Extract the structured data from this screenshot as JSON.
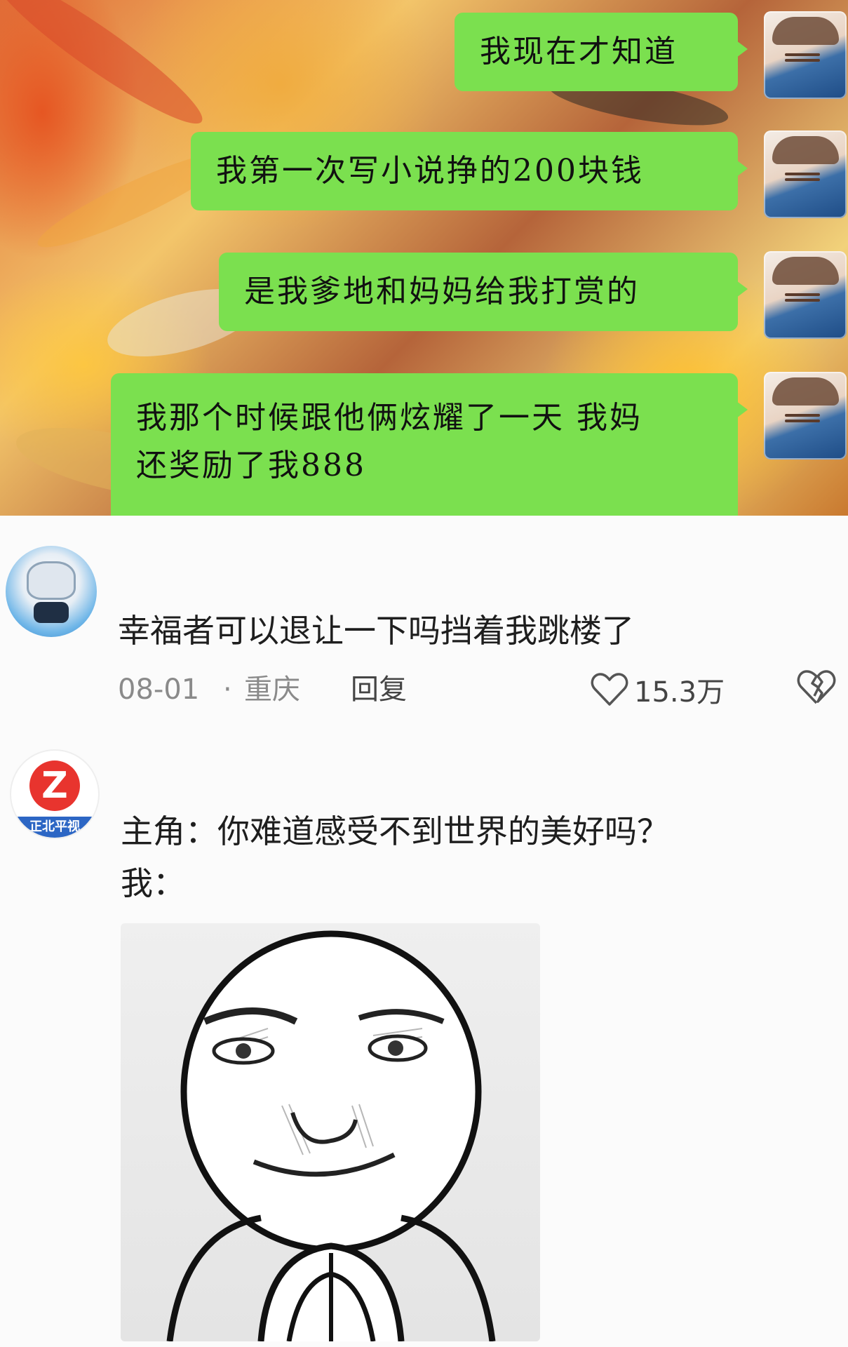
{
  "chat_screenshot": {
    "messages": [
      {
        "text": "我现在才知道"
      },
      {
        "text": "我第一次写小说挣的200块钱"
      },
      {
        "text": "是我爹地和妈妈给我打赏的"
      },
      {
        "line1": "我那个时候跟他俩炫耀了一天 我妈",
        "line2": "还奖励了我888"
      }
    ],
    "bubble_color": "#7be04f"
  },
  "comments": [
    {
      "text": "幸福者可以退让一下吗挡着我跳楼了",
      "date": "08-01",
      "separator": "·",
      "location": "重庆",
      "reply_label": "回复",
      "like_count": "15.3万"
    },
    {
      "line1": "主角：你难道感受不到世界的美好吗？",
      "line2": "我：",
      "avatar_logo": "Z",
      "avatar_band": "正北平视"
    }
  ]
}
